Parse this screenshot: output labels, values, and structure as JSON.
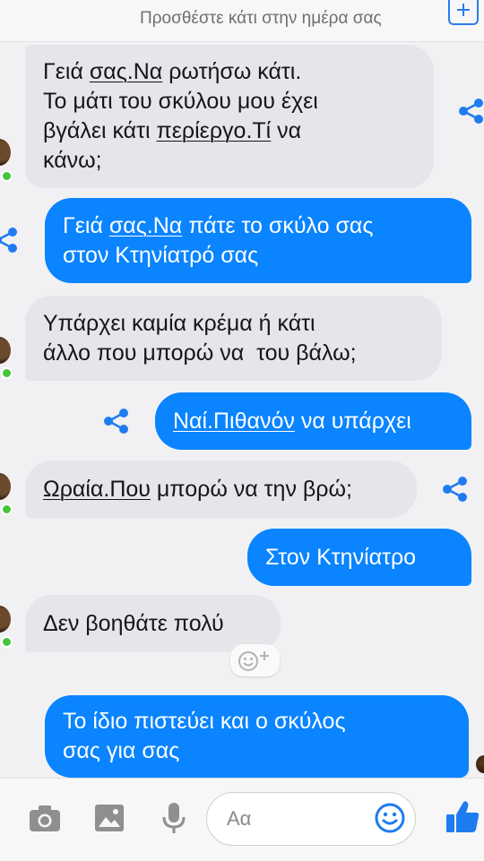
{
  "header": {
    "prompt_text": "Προσθέστε κάτι στην ημέρα σας",
    "add_icon": "plus-square-icon"
  },
  "messages": [
    {
      "from": "them",
      "lines": [
        [
          "Γειά ",
          {
            "u": "σας.Να"
          },
          " ρωτήσω κάτι."
        ],
        [
          "Το μάτι του σκύλου μου έχει"
        ],
        [
          "βγάλει κάτι ",
          {
            "u": "περίεργο.Τί"
          },
          " να"
        ],
        [
          "κάνω;"
        ]
      ]
    },
    {
      "from": "me",
      "lines": [
        [
          "Γειά ",
          {
            "u": "σας.Να"
          },
          " πάτε το σκύλο σας"
        ],
        [
          "στον Κτηνίατρό σας"
        ]
      ]
    },
    {
      "from": "them",
      "lines": [
        [
          "Υπάρχει καμία κρέμα ή κάτι"
        ],
        [
          "άλλο που μπορώ να  του βάλω;"
        ]
      ]
    },
    {
      "from": "me",
      "lines": [
        [
          {
            "u": "Ναί.Πιθανόν"
          },
          " να υπάρχει"
        ]
      ]
    },
    {
      "from": "them",
      "lines": [
        [
          {
            "u": "Ωραία.Που"
          },
          " μπορώ να την βρώ;"
        ]
      ]
    },
    {
      "from": "me",
      "lines": [
        [
          "Στον Κτηνίατρο"
        ]
      ]
    },
    {
      "from": "them",
      "lines": [
        [
          "Δεν βοηθάτε πολύ"
        ]
      ]
    },
    {
      "from": "me",
      "lines": [
        [
          "Το ίδιο πιστεύει και ο σκύλος"
        ],
        [
          "σας για σας"
        ]
      ]
    }
  ],
  "composer": {
    "placeholder": "Αα",
    "tools": [
      "camera-icon",
      "gallery-icon",
      "microphone-icon",
      "emoji-icon",
      "thumbs-up-icon"
    ]
  },
  "colors": {
    "outgoing_bubble": "#0a84ff",
    "incoming_bubble": "#e5e5ea",
    "accent": "#2a7cf0",
    "online": "#45c43a"
  }
}
